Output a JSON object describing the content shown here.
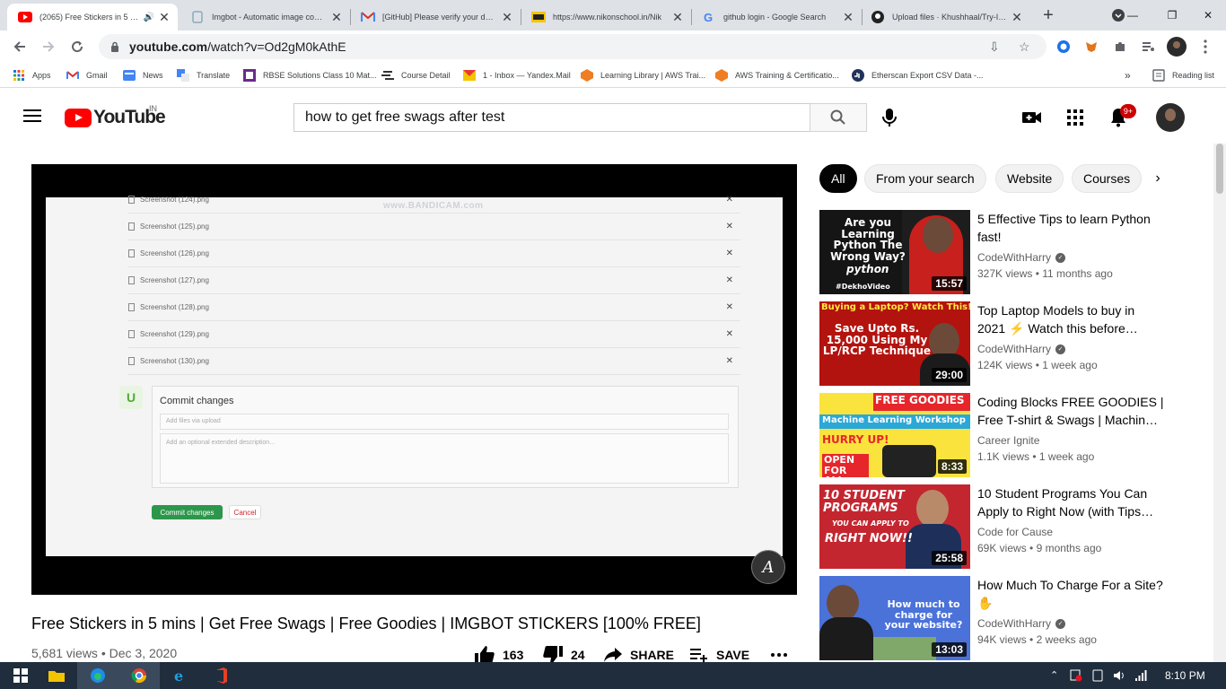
{
  "browser": {
    "tabs": [
      {
        "title": "(2065) Free Stickers in 5 mins",
        "active": true
      },
      {
        "title": "Imgbot - Automatic image compr",
        "active": false
      },
      {
        "title": "[GitHub] Please verify your device",
        "active": false
      },
      {
        "title": "https://www.nikonschool.in/Nik",
        "active": false
      },
      {
        "title": "github login - Google Search",
        "active": false
      },
      {
        "title": "Upload files · Khushhaal/Try-Img",
        "active": false
      }
    ],
    "url_domain": "youtube.com",
    "url_path": "/watch?v=Od2gM0kAthE",
    "bookmarks": [
      {
        "label": "Apps",
        "icon": "apps-grid-icon"
      },
      {
        "label": "Gmail",
        "icon": "gmail-icon"
      },
      {
        "label": "News",
        "icon": "news-icon"
      },
      {
        "label": "Translate",
        "icon": "translate-icon"
      },
      {
        "label": "RBSE Solutions Class 10 Mat...",
        "icon": "rbse-icon"
      },
      {
        "label": "Course Detail",
        "icon": "course-icon"
      },
      {
        "label": "1 - Inbox — Yandex.Mail",
        "icon": "mail-icon"
      },
      {
        "label": "Learning Library | AWS Trai...",
        "icon": "aws-icon"
      },
      {
        "label": "AWS Training & Certificatio...",
        "icon": "aws-icon"
      },
      {
        "label": "Etherscan Export CSV Data -...",
        "icon": "etherscan-icon"
      }
    ],
    "reading_list": "Reading list"
  },
  "youtube": {
    "logo_text": "YouTube",
    "country": "IN",
    "search_query": "how to get free swags after test",
    "notifications_badge": "9+"
  },
  "player": {
    "watermark": "www.BANDICAM.com",
    "files": [
      "Screenshot (124).png",
      "Screenshot (125).png",
      "Screenshot (126).png",
      "Screenshot (127).png",
      "Screenshot (128).png",
      "Screenshot (129).png",
      "Screenshot (130).png"
    ],
    "commit_title": "Commit changes",
    "commit_summary_placeholder": "Add files via upload",
    "commit_desc_placeholder": "Add an optional extended description...",
    "commit_button": "Commit changes",
    "cancel_button": "Cancel",
    "channel_watermark": "A"
  },
  "video": {
    "title": "Free Stickers in 5 mins | Get Free Swags | Free Goodies | IMGBOT STICKERS [100% FREE]",
    "views": "5,681 views",
    "date": "Dec 3, 2020",
    "likes": "163",
    "dislikes": "24",
    "share_label": "SHARE",
    "save_label": "SAVE"
  },
  "chips": [
    "All",
    "From your search",
    "Website",
    "Courses"
  ],
  "recommendations": [
    {
      "title": "5 Effective Tips to learn Python fast!",
      "channel": "CodeWithHarry",
      "verified": true,
      "views": "327K views",
      "age": "11 months ago",
      "duration": "15:57",
      "thumb_text": "Are you Learning Python The Wrong Way?",
      "thumb_sub": "python",
      "thumb_tag": "#DekhoVideo",
      "thumb_bg": "#1d1d1d",
      "thumb_accent": "#c8201c"
    },
    {
      "title": "Top Laptop Models to buy in 2021 ⚡ Watch this before…",
      "channel": "CodeWithHarry",
      "verified": true,
      "views": "124K views",
      "age": "1 week ago",
      "duration": "29:00",
      "thumb_text": "Save Upto Rs. 15,000 Using My LP/RCP Technique",
      "thumb_sub": "Buying a Laptop? Watch This!!!",
      "thumb_bg": "#b3130f",
      "thumb_accent": "#ffeb3b"
    },
    {
      "title": "Coding Blocks FREE GOODIES | Free T-shirt & Swags | Machin…",
      "channel": "Career Ignite",
      "verified": false,
      "views": "1.1K views",
      "age": "1 week ago",
      "duration": "8:33",
      "thumb_text": "FREE GOODIES",
      "thumb_sub": "Machine Learning Workshop",
      "thumb_tag": "HURRY UP!",
      "thumb_tag2": "OPEN FOR ALL",
      "thumb_bg": "#fbe33d",
      "thumb_accent": "#e6262b"
    },
    {
      "title": "10 Student Programs You Can Apply to Right Now (with Tips…",
      "channel": "Code for Cause",
      "verified": false,
      "views": "69K views",
      "age": "9 months ago",
      "duration": "25:58",
      "thumb_text": "10 STUDENT PROGRAMS",
      "thumb_sub": "YOU CAN APPLY TO",
      "thumb_tag": "RIGHT NOW!!",
      "thumb_bg": "#c42630",
      "thumb_accent": "#ffffff"
    },
    {
      "title": "How Much To Charge For a Site? ✋",
      "channel": "CodeWithHarry",
      "verified": true,
      "views": "94K views",
      "age": "2 weeks ago",
      "duration": "13:03",
      "thumb_text": "How much to charge for your website?",
      "thumb_bg": "#4a72d9",
      "thumb_accent": "#ffffff"
    }
  ],
  "taskbar": {
    "time": "8:10 PM"
  }
}
